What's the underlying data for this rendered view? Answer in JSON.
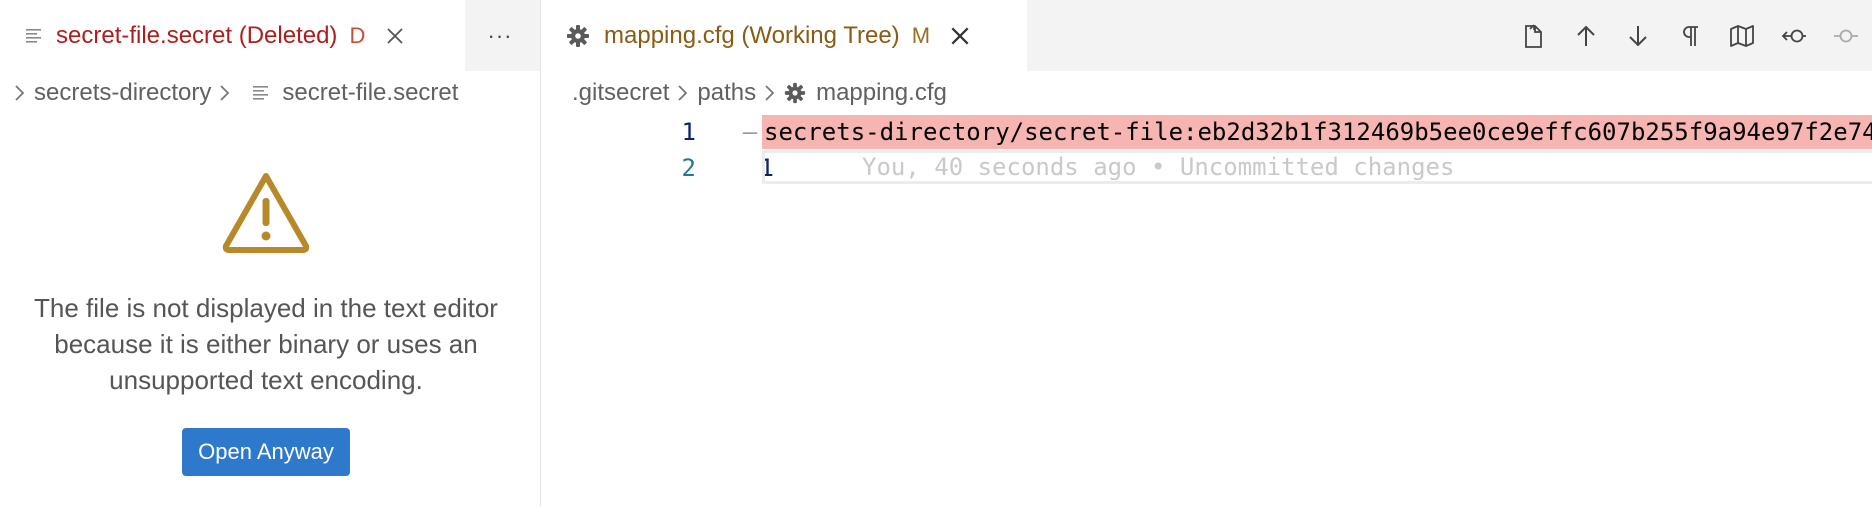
{
  "left_editor": {
    "tab": {
      "title": "secret-file.secret (Deleted)",
      "decoration": "D",
      "icon": "file-lines-icon"
    },
    "more_actions_label": "···",
    "breadcrumb": {
      "folder": "secrets-directory",
      "file": "secret-file.secret"
    },
    "notice": {
      "icon": "warning-icon",
      "message": "The file is not displayed in the text editor because it is either binary or uses an unsupported text encoding.",
      "button_label": "Open Anyway"
    }
  },
  "right_editor": {
    "tab": {
      "title": "mapping.cfg (Working Tree)",
      "decoration": "M",
      "icon": "gear-icon"
    },
    "breadcrumb": {
      "root": ".gitsecret",
      "folder": "paths",
      "file": "mapping.cfg"
    },
    "toolbar_icons": [
      "open-changes-icon",
      "previous-change-icon",
      "next-change-icon",
      "pilcrow-icon",
      "map-icon",
      "revert-icon",
      "commit-icon"
    ],
    "lines": [
      {
        "original_number": "1",
        "modified_number": "",
        "marker": "—",
        "text": "secrets-directory/secret-file:eb2d32b1f312469b5ee0ce9effc607b255f9a94e97f2e74"
      },
      {
        "original_number": "2",
        "modified_number": "1",
        "marker": "",
        "text": "You, 40 seconds ago • Uncommitted changes"
      }
    ]
  },
  "colors": {
    "deleted_tab_title": "#ad1f1f",
    "modified_tab_title": "#8a5b13",
    "removed_line_bg": "#f7b5b1",
    "button_bg": "#2f79cc",
    "warning": "#b8892b"
  }
}
